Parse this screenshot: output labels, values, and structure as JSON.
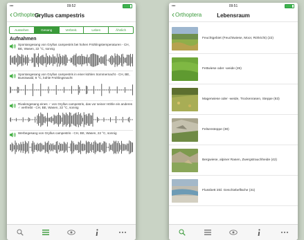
{
  "left_screen": {
    "status": {
      "time": "09:52"
    },
    "nav": {
      "back_label": "Orthoptera",
      "title": "Gryllus campestris"
    },
    "segments": [
      {
        "label": "Aussehen",
        "active": false
      },
      {
        "label": "Gesang",
        "active": true
      },
      {
        "label": "Verbreit.",
        "active": false
      },
      {
        "label": "Leben",
        "active": false
      },
      {
        "label": "Ähnlich",
        "active": false
      }
    ],
    "section_title": "Aufnahmen",
    "recordings": [
      {
        "description": "Spontangesang von Gryllus campestris bei hohen Frühlingstemperaturen - CH, BE, Wasen, 22 °C, sonnig"
      },
      {
        "description": "Spontangesang von Gryllus campestris in einer kühlen Sommernacht - CH, BE, Bumiswald, 8 °C, kühle Frühlingsnacht"
      },
      {
        "description": "Rivalengesang eines ♂ von Gryllus campestris, das vor seiner Höhle ein anderes ♂ verfreibt - CH, BE, Wasen, 22 °C, sonnig"
      },
      {
        "description": "Werbegesang von Gryllus campestris - CH, BE, Wasen, 22 °C, sonnig"
      }
    ]
  },
  "right_screen": {
    "status": {
      "time": "09:51"
    },
    "nav": {
      "back_label": "Orthoptera",
      "title": "Lebensraum"
    },
    "habitats": [
      {
        "name": "Feuchtgebiet (Feuchtwiese, Moor, Röhricht) (22)"
      },
      {
        "name": "Fettwiese oder -weide (26)"
      },
      {
        "name": "Magerwiese oder -weide, Trockenrasen, Steppe (83)"
      },
      {
        "name": "Felsensteppe (38)"
      },
      {
        "name": "Bergwiese, alpiner Rasen, Zwergstrauchheide (42)"
      },
      {
        "name": "Flussbett inkl. Geschiebefläche (31)"
      }
    ]
  },
  "colors": {
    "accent": "#3a9a3a",
    "background": "#c9d3c5"
  },
  "icons": {
    "tabs": [
      "search-icon",
      "list-icon",
      "eye-icon",
      "info-icon",
      "more-icon"
    ]
  }
}
